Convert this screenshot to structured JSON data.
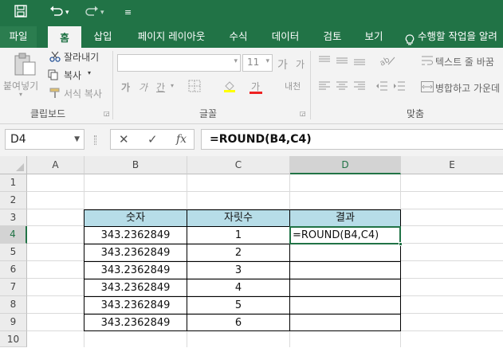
{
  "quick_access": {
    "save_icon": "save-icon",
    "undo_icon": "undo-icon",
    "redo_icon": "redo-icon",
    "customize_icon": "customize-icon"
  },
  "tabs": [
    {
      "label": "파일"
    },
    {
      "label": "홈"
    },
    {
      "label": "삽입"
    },
    {
      "label": "페이지 레이아웃"
    },
    {
      "label": "수식"
    },
    {
      "label": "데이터"
    },
    {
      "label": "검토"
    },
    {
      "label": "보기"
    }
  ],
  "tell_me": "수행할 작업을 알려",
  "ribbon": {
    "clipboard": {
      "paste": "붙여넣기",
      "cut": "잘라내기",
      "copy": "복사",
      "format_painter": "서식 복사",
      "group": "클립보드"
    },
    "font": {
      "font_name": "",
      "font_size": "11",
      "grow": "가",
      "shrink": "가",
      "bold": "가",
      "italic": "가",
      "underline": "간",
      "font_color": "가",
      "phonetic": "내천",
      "group": "글꼴"
    },
    "alignment": {
      "wrap_text": "텍스트 줄 바꿈",
      "merge": "병합하고 가운데",
      "group": "맞춤"
    }
  },
  "formula_bar": {
    "name_box": "D4",
    "cancel": "✕",
    "enter": "✓",
    "fx": "fx",
    "formula": "=ROUND(B4,C4)"
  },
  "grid": {
    "columns": [
      "A",
      "B",
      "C",
      "D",
      "E"
    ],
    "rows": [
      "1",
      "2",
      "3",
      "4",
      "5",
      "6",
      "7",
      "8",
      "9",
      "10"
    ],
    "table_headers": [
      "숫자",
      "자릿수",
      "결과"
    ],
    "table_rows": [
      [
        "343.2362849",
        "1",
        "=ROUND(B4,C4)"
      ],
      [
        "343.2362849",
        "2",
        ""
      ],
      [
        "343.2362849",
        "3",
        ""
      ],
      [
        "343.2362849",
        "4",
        ""
      ],
      [
        "343.2362849",
        "5",
        ""
      ],
      [
        "343.2362849",
        "6",
        ""
      ]
    ],
    "active_cell": "D4"
  },
  "colors": {
    "excel_green": "#217346",
    "header_fill": "#b7dde8"
  }
}
